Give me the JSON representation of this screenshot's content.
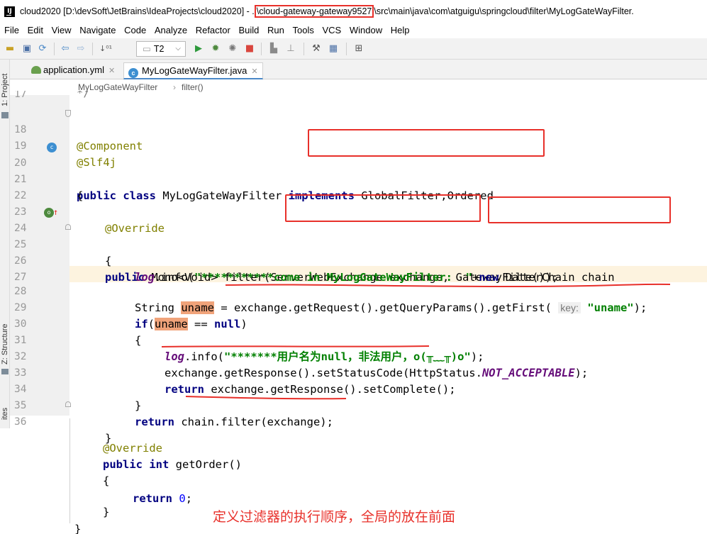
{
  "window": {
    "title_prefix": "cloud2020 [D:\\devSoft\\JetBrains\\IdeaProjects\\cloud2020] - .",
    "title_module": "\\cloud-gateway-gateway9527",
    "title_suffix": "\\src\\main\\java\\com\\atguigu\\springcloud\\filter\\MyLogGateWayFilter.",
    "icon_label": "IJ"
  },
  "menu": [
    "File",
    "Edit",
    "View",
    "Navigate",
    "Code",
    "Analyze",
    "Refactor",
    "Build",
    "Run",
    "Tools",
    "VCS",
    "Window",
    "Help"
  ],
  "toolbar": {
    "run_config": "T2"
  },
  "tool_windows": {
    "project": "1: Project",
    "structure": "Z: Structure",
    "favorites": "ites"
  },
  "tabs": [
    {
      "label": "application.yml",
      "active": false
    },
    {
      "label": "MyLogGateWayFilter.java",
      "active": true
    }
  ],
  "breadcrumb": {
    "class_name": "MyLogGateWayFilter",
    "sep": "›",
    "method": "filter()"
  },
  "line_numbers": [
    "17",
    "18",
    "19",
    "20",
    "21",
    "22",
    "23",
    "24",
    "25",
    "26",
    "27",
    "28",
    "29",
    "30",
    "31",
    "32",
    "33",
    "34",
    "35",
    "36"
  ],
  "code": {
    "l17": "*/",
    "l18": "@Component",
    "l19": "@Slf4j",
    "l20_kw": "public class ",
    "l20_name": "MyLogGateWayFilter ",
    "l20_impl": "implements",
    "l20_rest": " GlobalFilter,Ordered",
    "l21": "{",
    "l23": "@Override",
    "l24_kw": "public ",
    "l24_type": "Mono<Void> filter(",
    "l24_p1": "ServerWebExchange exchange",
    "l24_comma": ", ",
    "l24_p2": "GatewayFilterChain chain",
    "l25": "{",
    "l26_log": "log",
    "l26_a": ".info(",
    "l26_str": "\"***********come in MyLogGateWayFilter:  \"",
    "l26_b": "+",
    "l26_new": "new",
    "l26_c": " Date());",
    "l28_a": "String ",
    "l28_var": "uname",
    "l28_b": " = exchange.getRequest().getQueryParams().getFirst( ",
    "l28_hint": "key:",
    "l28_str": " \"uname\"",
    "l28_c": ");",
    "l29_kw": "if",
    "l29_a": "(",
    "l29_var": "uname",
    "l29_b": " == ",
    "l29_null": "null",
    "l29_c": ")",
    "l30": "{",
    "l31_log": "log",
    "l31_a": ".info(",
    "l31_str": "\"*******用户名为null，非法用户，o(╥﹏╥)o\"",
    "l31_c": ");",
    "l32_a": "exchange.getResponse().setStatusCode(HttpStatus.",
    "l32_const": "NOT_ACCEPTABLE",
    "l32_c": ");",
    "l33_kw": "return",
    "l33_a": " exchange.getResponse().setComplete();",
    "l34": "}",
    "l35_kw": "return",
    "l35_a": " chain.filter(exchange);",
    "l36": "}",
    "o_override": "@Override",
    "o_kw": "public int",
    "o_sig": " getOrder()",
    "o_open": "{",
    "o_ret": "return",
    "o_zero": "0",
    "o_semi": ";",
    "o_close": "}",
    "class_close": "}"
  },
  "annotation": {
    "comment": "定义过滤器的执行顺序，全局的放在前面"
  },
  "colors": {
    "markup_red": "#e8302a",
    "keyword": "#000080",
    "annotation": "#808000",
    "string": "#008000",
    "highlight": "#fdf3df"
  }
}
